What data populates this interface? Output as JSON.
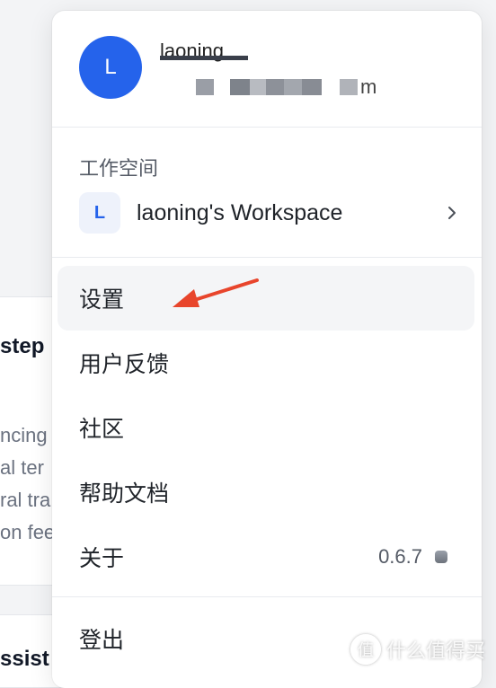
{
  "background": {
    "card1_title": "step",
    "card1_lines": [
      "ncing",
      "al ter",
      "ral tra",
      "on fee"
    ],
    "card2_title": "ssist"
  },
  "user": {
    "avatar_letter": "L",
    "name": "laoning",
    "email_tail": "m"
  },
  "workspace": {
    "section_label": "工作空间",
    "icon_letter": "L",
    "name": "laoning's Workspace"
  },
  "menu": {
    "settings": "设置",
    "feedback": "用户反馈",
    "community": "社区",
    "docs": "帮助文档",
    "about": "关于",
    "version": "0.6.7",
    "logout": "登出"
  },
  "watermark": {
    "icon_char": "值",
    "text": "什么值得买"
  },
  "colors": {
    "accent": "#2563eb",
    "annotation_arrow": "#e8452c"
  }
}
